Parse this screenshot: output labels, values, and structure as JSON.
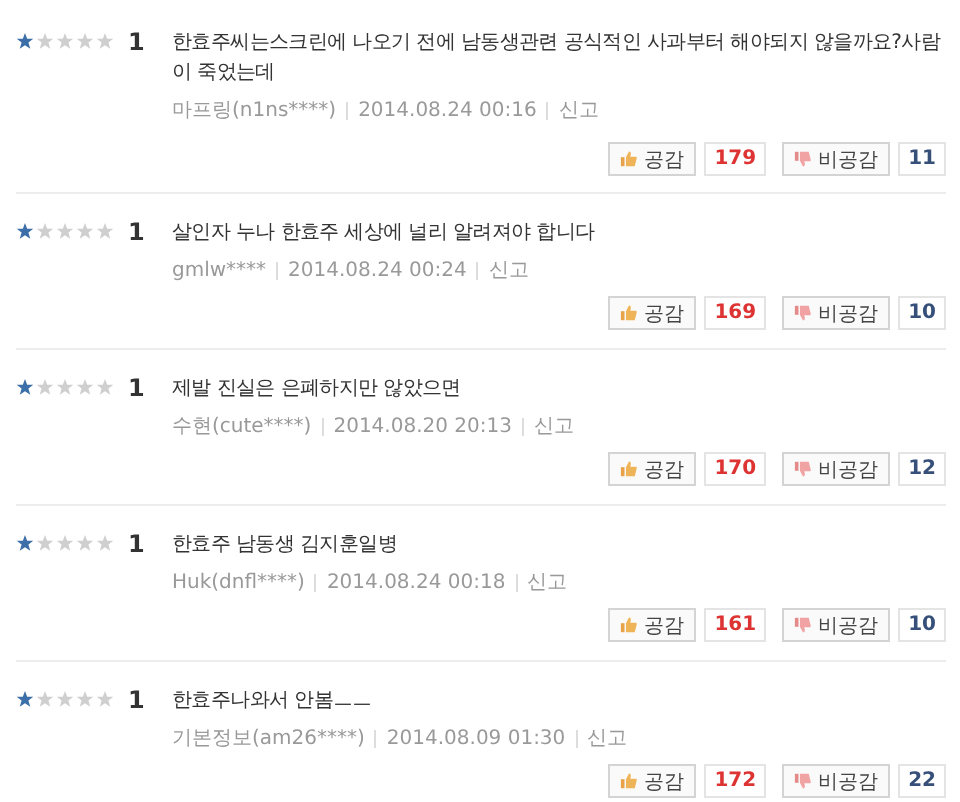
{
  "reviews": [
    {
      "stars": 1,
      "score": "1",
      "text": "한효주씨는스크린에 나오기 전에 남동생관련 공식적인 사과부터 해야되지 않을까요?사람이 죽었는데",
      "author": "마프링(n1ns****)",
      "date": "2014.08.24 00:16",
      "report": "신고",
      "like_label": "공감",
      "likes": "179",
      "dislike_label": "비공감",
      "dislikes": "11"
    },
    {
      "stars": 1,
      "score": "1",
      "text": "살인자 누나 한효주 세상에 널리 알려져야 합니다",
      "author": "gmlw****",
      "date": "2014.08.24 00:24",
      "report": "신고",
      "like_label": "공감",
      "likes": "169",
      "dislike_label": "비공감",
      "dislikes": "10"
    },
    {
      "stars": 1,
      "score": "1",
      "text": "제발 진실은 은폐하지만 않았으면",
      "author": "수현(cute****)",
      "date": "2014.08.20 20:13",
      "report": "신고",
      "like_label": "공감",
      "likes": "170",
      "dislike_label": "비공감",
      "dislikes": "12"
    },
    {
      "stars": 1,
      "score": "1",
      "text": "한효주 남동생 김지훈일병",
      "author": "Huk(dnfl****)",
      "date": "2014.08.24 00:18",
      "report": "신고",
      "like_label": "공감",
      "likes": "161",
      "dislike_label": "비공감",
      "dislikes": "10"
    },
    {
      "stars": 1,
      "score": "1",
      "text": "한효주나와서 안봄ㅡㅡ",
      "author": "기본정보(am26****)",
      "date": "2014.08.09 01:30",
      "report": "신고",
      "like_label": "공감",
      "likes": "172",
      "dislike_label": "비공감",
      "dislikes": "22"
    }
  ]
}
